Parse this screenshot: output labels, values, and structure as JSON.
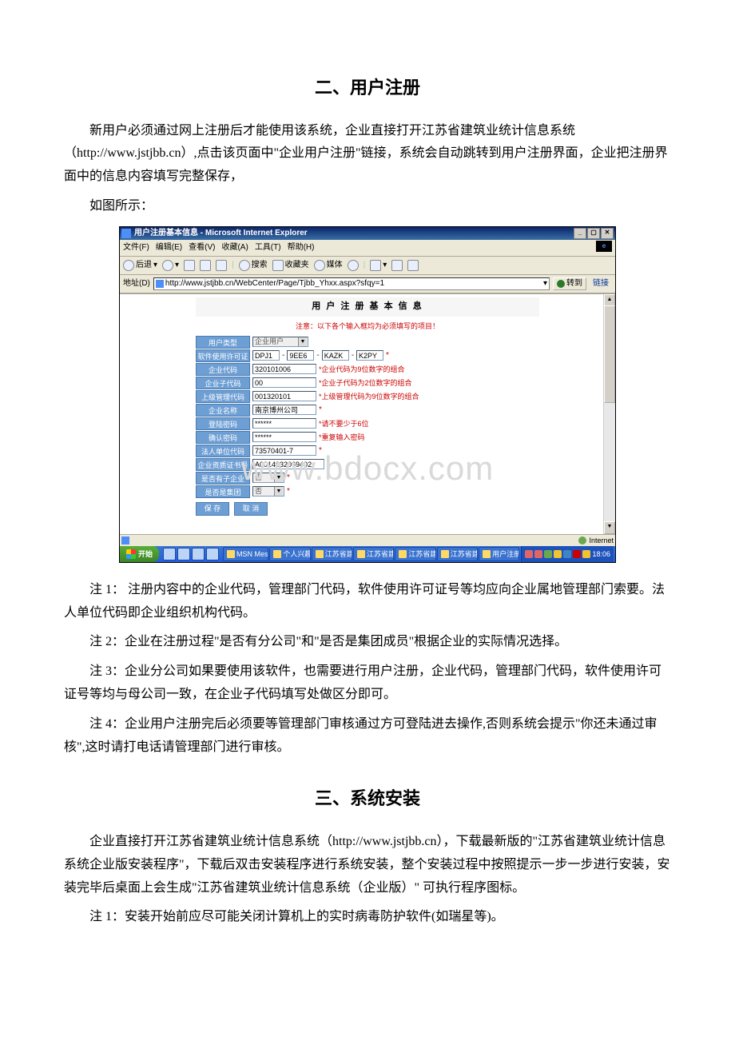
{
  "section2": {
    "title": "二、用户注册",
    "para1": "新用户必须通过网上注册后才能使用该系统，企业直接打开江苏省建筑业统计信息系统（http://www.jstjbb.cn）,点击该页面中\"企业用户注册\"链接，系统会自动跳转到用户注册界面，企业把注册界面中的信息内容填写完整保存，",
    "para2": "如图所示：",
    "note1": "注 1： 注册内容中的企业代码，管理部门代码，软件使用许可证号等均应向企业属地管理部门索要。法人单位代码即企业组织机构代码。",
    "note2": "注 2：企业在注册过程\"是否有分公司\"和\"是否是集团成员\"根据企业的实际情况选择。",
    "note3": "注 3：企业分公司如果要使用该软件，也需要进行用户注册，企业代码，管理部门代码，软件使用许可证号等均与母公司一致，在企业子代码填写处做区分即可。",
    "note4": "注 4：企业用户注册完后必须要等管理部门审核通过方可登陆进去操作,否则系统会提示\"你还未通过审核\",这时请打电话请管理部门进行审核。"
  },
  "section3": {
    "title": "三、系统安装",
    "para1": "企业直接打开江苏省建筑业统计信息系统（http://www.jstjbb.cn），下载最新版的\"江苏省建筑业统计信息系统企业版安装程序\"，下载后双击安装程序进行系统安装，整个安装过程中按照提示一步一步进行安装，安装完毕后桌面上会生成\"江苏省建筑业统计信息系统（企业版）\" 可执行程序图标。",
    "note1": "注 1：安装开始前应尽可能关闭计算机上的实时病毒防护软件(如瑞星等)。"
  },
  "browser": {
    "title": "用户注册基本信息 - Microsoft Internet Explorer",
    "menu": {
      "file": "文件(F)",
      "edit": "编辑(E)",
      "view": "查看(V)",
      "fav": "收藏(A)",
      "tools": "工具(T)",
      "help": "帮助(H)"
    },
    "toolbar": {
      "back": "后退",
      "search": "搜索",
      "fav": "收藏夹",
      "media": "媒体"
    },
    "addr_label": "地址(D)",
    "url": "http://www.jstjbb.cn/WebCenter/Page/Tjbb_Yhxx.aspx?sfqy=1",
    "go": "转到",
    "links": "链接",
    "status_left": "",
    "status_right": "Internet"
  },
  "form": {
    "title": "用 户 注 册 基 本 信 息",
    "warning": "注意：以下各个输入框均为必须填写的项目！",
    "rows": {
      "user_type": {
        "label": "用户类型",
        "value": "企业用户"
      },
      "license": {
        "label": "软件使用许可证号",
        "v1": "DPJ1",
        "v2": "9EE6",
        "v3": "KAZK",
        "v4": "K2PY"
      },
      "ent_code": {
        "label": "企业代码",
        "value": "320101006",
        "hint": "*企业代码为9位数字的组合"
      },
      "sub_code": {
        "label": "企业子代码",
        "value": "00",
        "hint": "*企业子代码为2位数字的组合"
      },
      "mgr_code": {
        "label": "上级管理代码",
        "value": "001320101",
        "hint": "*上级管理代码为9位数字的组合"
      },
      "ent_name": {
        "label": "企业名称",
        "value": "南京博州公司"
      },
      "login_pwd": {
        "label": "登陆密码",
        "value": "******",
        "hint": "*请不要少于6位"
      },
      "confirm_pwd": {
        "label": "确认密码",
        "value": "******",
        "hint": "*重复输入密码"
      },
      "legal_code": {
        "label": "法人单位代码",
        "value": "73570401-7"
      },
      "cert_no": {
        "label": "企业资质证书号",
        "value": "A0014032069402"
      },
      "has_sub": {
        "label": "是否有子企业",
        "value": "否"
      },
      "is_group": {
        "label": "是否是集团",
        "value": "否"
      }
    },
    "save_btn": "保 存",
    "cancel_btn": "取 消"
  },
  "watermark": "www.bdocx.com",
  "taskbar": {
    "start": "开始",
    "tasks": [
      "MSN Mess...",
      "个人兴趣...",
      "江苏省建...",
      "江苏省建...",
      "江苏省建...",
      "江苏省建...",
      "用户注册..."
    ],
    "clock": "18:06"
  }
}
